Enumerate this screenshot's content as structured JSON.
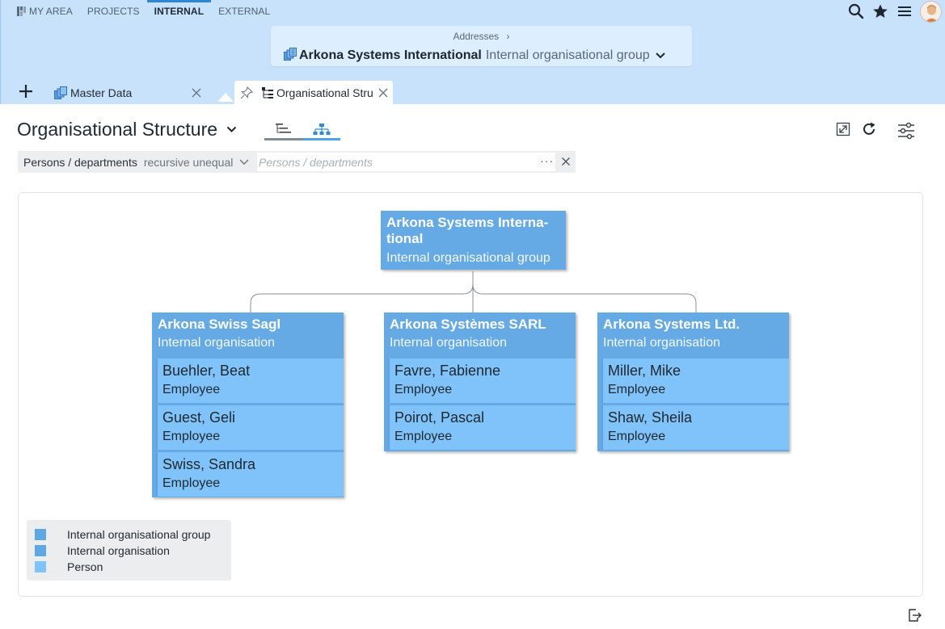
{
  "nav": {
    "items": [
      "MY AREA",
      "PROJECTS",
      "INTERNAL",
      "EXTERNAL"
    ],
    "active": "INTERNAL"
  },
  "context": {
    "breadcrumb": "Addresses",
    "breadcrumb_sep": "›",
    "title": "Arkona Systems International",
    "subtitle": "Internal organisational group"
  },
  "tabs": [
    {
      "label": "Master Data",
      "active": false
    },
    {
      "label": "Organisational Stru",
      "active": true
    }
  ],
  "page": {
    "title": "Organisational Structure"
  },
  "filter": {
    "field": "Persons / departments",
    "operator": "recursive unequal",
    "placeholder": "Persons / departments",
    "more": "···"
  },
  "org": {
    "root": {
      "title_line1": "Arkona Systems Interna-",
      "title_line2": "tional",
      "subtitle": "Internal organisational group"
    },
    "children": [
      {
        "title": "Arkona Swiss Sagl",
        "subtitle": "Internal organisation",
        "persons": [
          {
            "name": "Buehler, Beat",
            "role": "Employee"
          },
          {
            "name": "Guest, Geli",
            "role": "Employee"
          },
          {
            "name": "Swiss, Sandra",
            "role": "Employee"
          }
        ]
      },
      {
        "title": "Arkona Systèmes SARL",
        "subtitle": "Internal organisation",
        "persons": [
          {
            "name": "Favre, Fabienne",
            "role": "Employee"
          },
          {
            "name": "Poirot, Pascal",
            "role": "Employee"
          }
        ]
      },
      {
        "title": "Arkona Systems Ltd.",
        "subtitle": "Internal organisation",
        "persons": [
          {
            "name": "Miller, Mike",
            "role": "Employee"
          },
          {
            "name": "Shaw, Sheila",
            "role": "Employee"
          }
        ]
      }
    ]
  },
  "legend": [
    {
      "label": "Internal organisational group",
      "color": "#5fa8e3"
    },
    {
      "label": "Internal organisation",
      "color": "#5fa8e3"
    },
    {
      "label": "Person",
      "color": "#80c3fa"
    }
  ],
  "colors": {
    "header_bg": "#c9e2fb",
    "accent": "#2e86d6",
    "org_node": "#66aae5",
    "person_node": "#80c3fa"
  },
  "icons": {
    "search": "search-icon",
    "favorites": "star-icon",
    "menu": "hamburger-menu-icon",
    "user": "avatar"
  }
}
